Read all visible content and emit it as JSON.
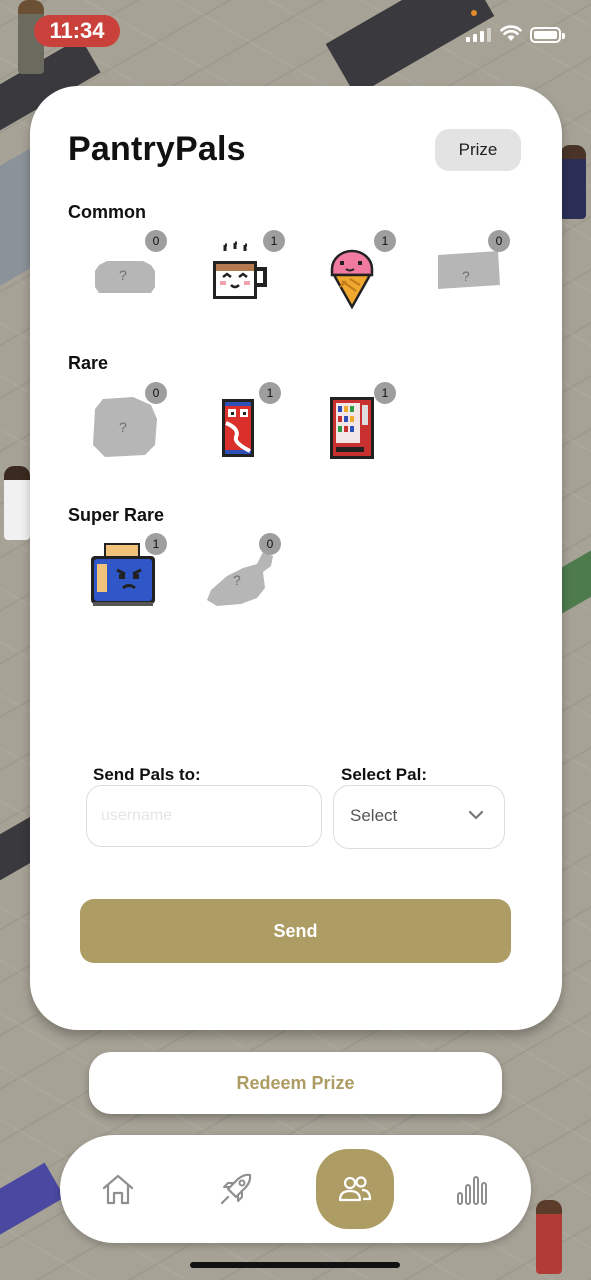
{
  "status_bar": {
    "time": "11:34"
  },
  "header": {
    "app_title": "PantryPals",
    "prize_label": "Prize"
  },
  "sections": [
    {
      "title": "Common",
      "pals": [
        {
          "name": "bread-loaf",
          "count": "0",
          "locked": true,
          "lock_label": "?"
        },
        {
          "name": "coffee-cup",
          "count": "1",
          "locked": false
        },
        {
          "name": "ice-cream-cone",
          "count": "1",
          "locked": false
        },
        {
          "name": "cheese-block",
          "count": "0",
          "locked": true,
          "lock_label": "?"
        }
      ]
    },
    {
      "title": "Rare",
      "pals": [
        {
          "name": "cookie",
          "count": "0",
          "locked": true,
          "lock_label": "?"
        },
        {
          "name": "soda-can",
          "count": "1",
          "locked": false
        },
        {
          "name": "vending-machine",
          "count": "1",
          "locked": false
        }
      ]
    },
    {
      "title": "Super Rare",
      "pals": [
        {
          "name": "toaster",
          "count": "1",
          "locked": false
        },
        {
          "name": "chicken-drumstick",
          "count": "0",
          "locked": true,
          "lock_label": "?"
        }
      ]
    }
  ],
  "send_form": {
    "to_label": "Send Pals to:",
    "username_placeholder": "username",
    "username_value": "",
    "select_label": "Select Pal:",
    "select_value": "Select",
    "send_label": "Send"
  },
  "redeem_label": "Redeem Prize",
  "tabbar": {
    "items": [
      {
        "icon": "home-icon",
        "active": false
      },
      {
        "icon": "rocket-icon",
        "active": false
      },
      {
        "icon": "users-icon",
        "active": true
      },
      {
        "icon": "bar-chart-icon",
        "active": false
      }
    ]
  },
  "colors": {
    "accent": "#ad9c63",
    "badge": "#9e9e9e",
    "card": "#ffffff",
    "locked": "#b6b6b6"
  }
}
